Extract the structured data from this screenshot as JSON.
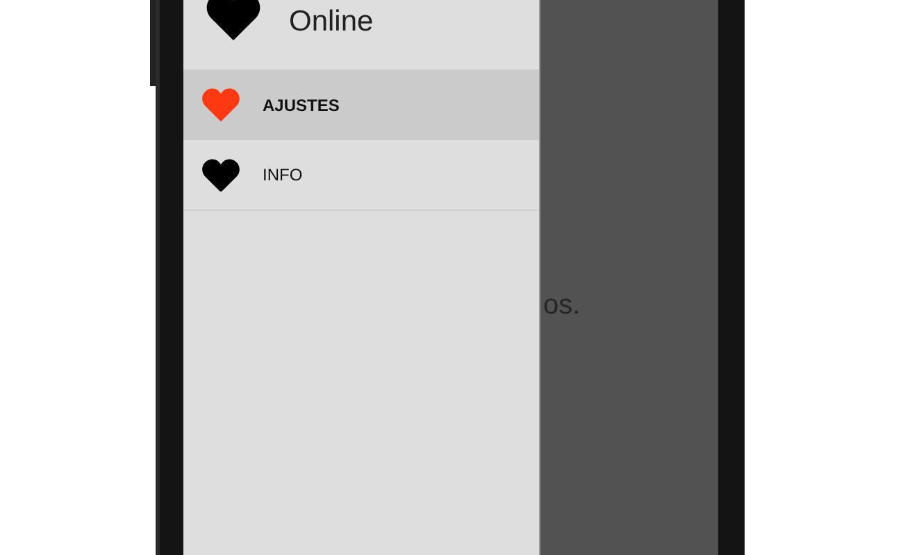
{
  "drawer": {
    "header": {
      "title": "Online"
    },
    "items": [
      {
        "label": "AJUSTES",
        "selected": true
      },
      {
        "label": "INFO",
        "selected": false
      }
    ]
  },
  "content": {
    "text": "os."
  }
}
